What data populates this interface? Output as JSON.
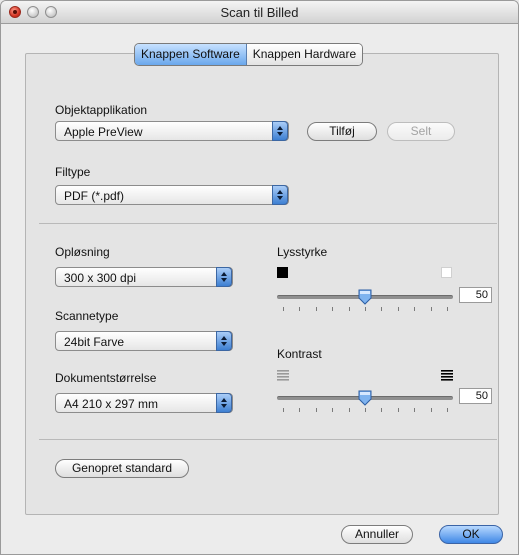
{
  "window": {
    "title": "Scan til Billed"
  },
  "tabs": [
    {
      "label": "Knappen Software",
      "active": true
    },
    {
      "label": "Knappen Hardware",
      "active": false
    }
  ],
  "target_app": {
    "label": "Objektapplikation",
    "value": "Apple PreView",
    "add_button": "Tilføj",
    "delete_button": "Selt"
  },
  "file_type": {
    "label": "Filtype",
    "value": "PDF (*.pdf)"
  },
  "resolution": {
    "label": "Opløsning",
    "value": "300 x 300 dpi"
  },
  "scan_type": {
    "label": "Scannetype",
    "value": "24bit Farve"
  },
  "document_size": {
    "label": "Dokumentstørrelse",
    "value": "A4 210 x 297 mm"
  },
  "brightness": {
    "label": "Lysstyrke",
    "value": "50"
  },
  "contrast": {
    "label": "Kontrast",
    "value": "50"
  },
  "restore_button": "Genopret standard",
  "cancel_button": "Annuller",
  "ok_button": "OK",
  "colors": {
    "accent": "#3f88e6",
    "close": "#d0301f"
  }
}
